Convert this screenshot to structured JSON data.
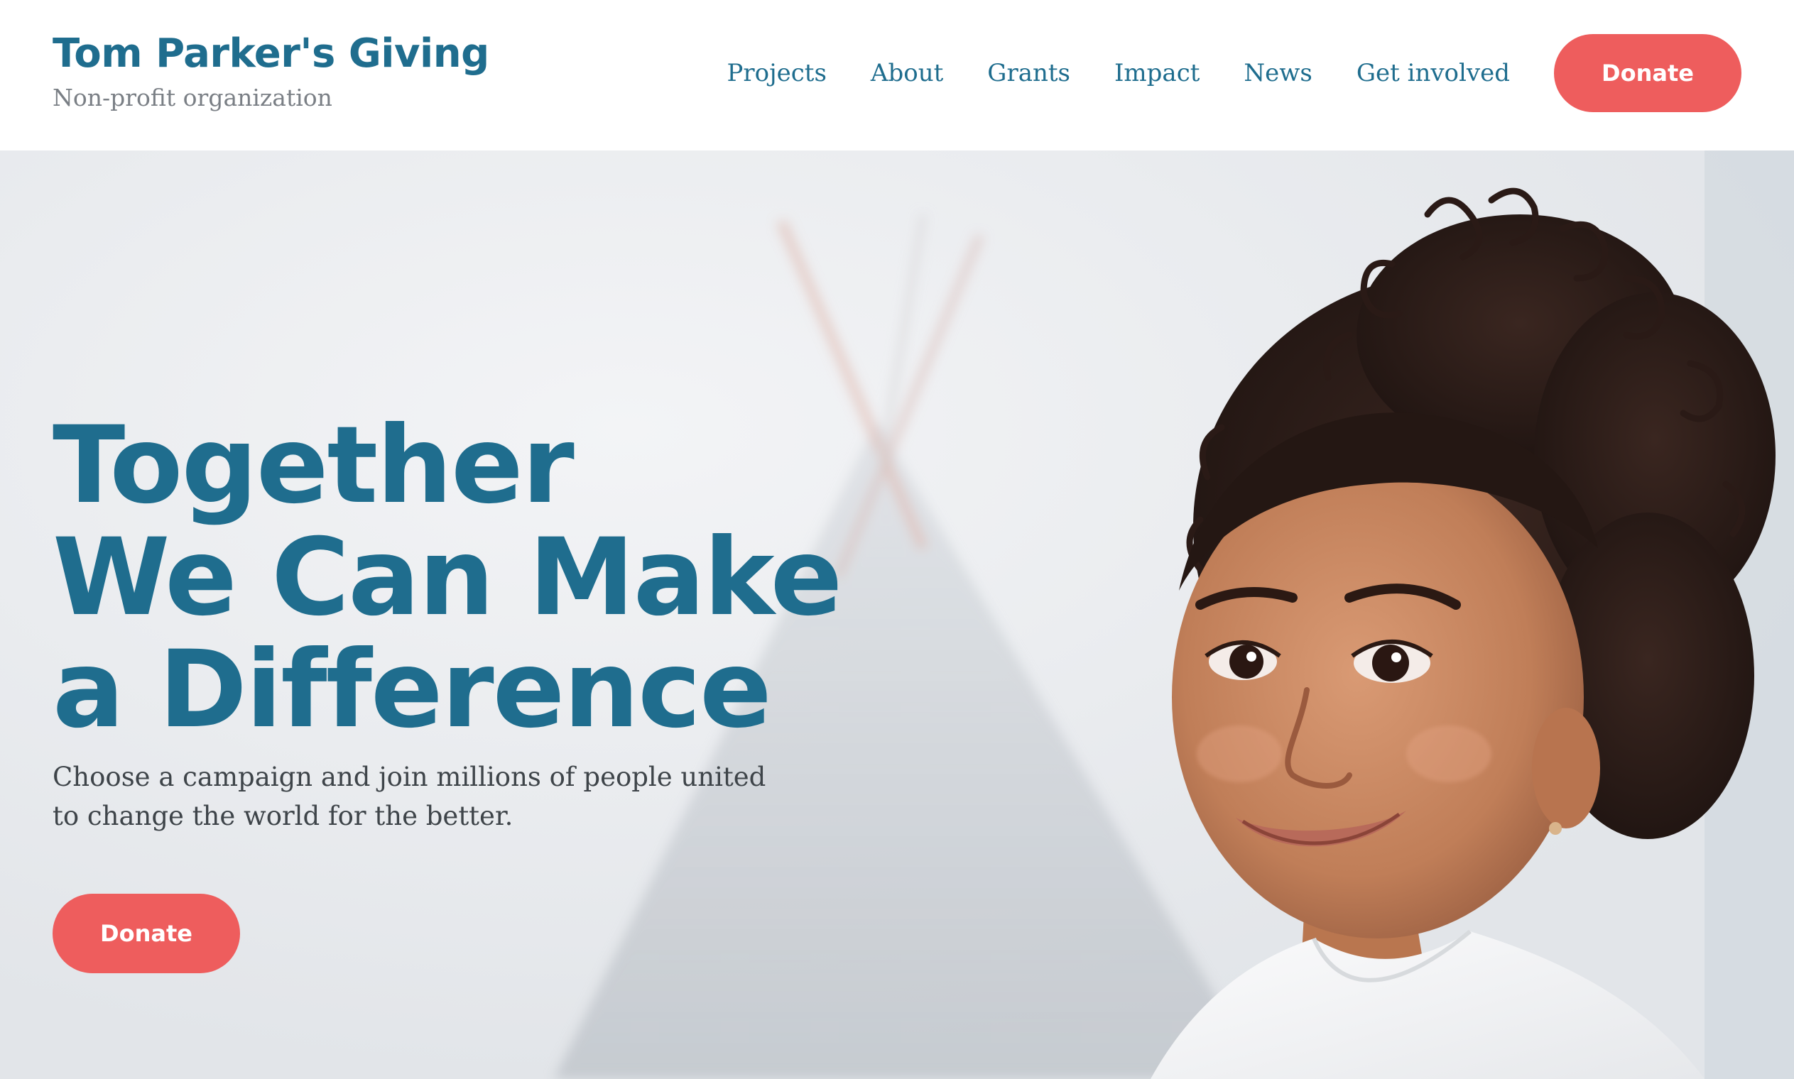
{
  "header": {
    "brand_title": "Tom Parker's Giving",
    "brand_subtitle": "Non-profit organization",
    "nav": {
      "projects": "Projects",
      "about": "About",
      "grants": "Grants",
      "impact": "Impact",
      "news": "News",
      "get_involved": "Get involved"
    },
    "donate_label": "Donate"
  },
  "hero": {
    "heading_lines": [
      "Together",
      "We Can Make",
      "a Difference"
    ],
    "text_lines": [
      "Choose a campaign and join millions of people united",
      "to change the world for the better."
    ],
    "donate_label": "Donate",
    "image_icon": "child-portrait-photo"
  },
  "colors": {
    "primary": "#1f6d8e",
    "accent": "#ee5d5d",
    "subtitle": "#7a7f85",
    "body_text": "#3e4449",
    "header_bg": "#ffffff"
  }
}
